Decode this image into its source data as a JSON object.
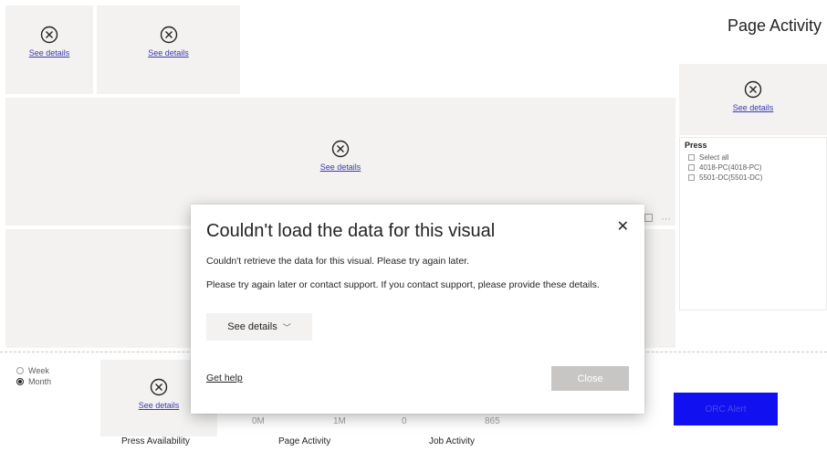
{
  "page": {
    "title": "Page Activity"
  },
  "error_tiles": {
    "see_details": "See details"
  },
  "slicer": {
    "title": "Press",
    "items": [
      "Select all",
      "4018-PC(4018-PC)",
      "5501-DC(5501-DC)"
    ]
  },
  "period": {
    "options": [
      "Week",
      "Month"
    ],
    "selected": "Month"
  },
  "cards": {
    "page_activity": {
      "left": "0M",
      "right": "1M",
      "caption": "Page Activity"
    },
    "job_activity": {
      "left": "0",
      "right": "865",
      "caption": "Job Activity"
    },
    "press_availability": {
      "caption": "Press Availability"
    }
  },
  "orc_button": {
    "label": "ORC Alert"
  },
  "visual_header": {
    "more_icon": "···"
  },
  "dialog": {
    "title": "Couldn't load the data for this visual",
    "message": "Couldn't retrieve the data for this visual. Please try again later.",
    "detail": "Please try again later or contact support. If you contact support, please provide these details.",
    "see_details_label": "See details",
    "chevron": "﹀",
    "close_x": "✕",
    "get_help": "Get help",
    "close_label": "Close"
  },
  "colors": {
    "tile_bg": "#f3f2f1",
    "link": "#3a3ab0",
    "orc_button": "#1010f0",
    "close_button": "#c8c6c4"
  }
}
